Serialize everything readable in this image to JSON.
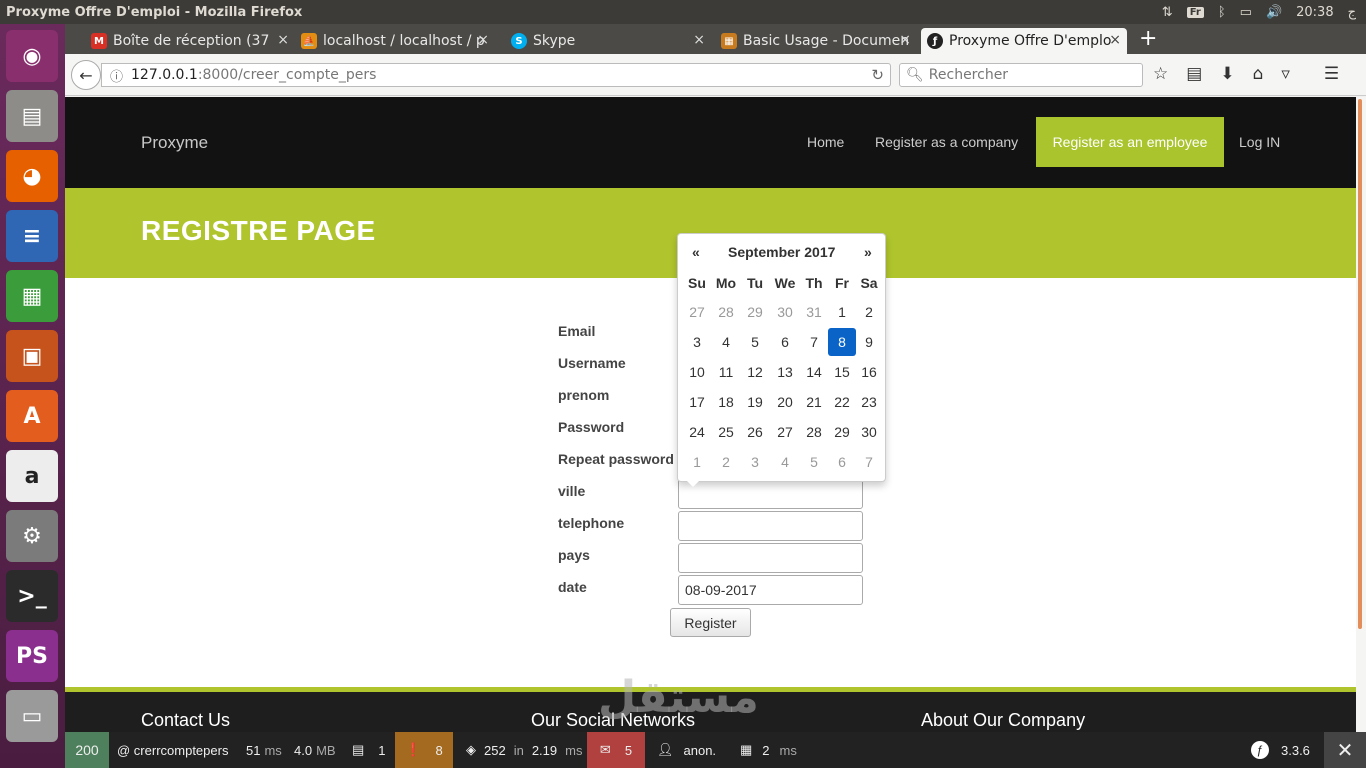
{
  "system": {
    "window_title": "Proxyme Offre D'emploi - Mozilla Firefox",
    "keyboard": "Fr",
    "time": "20:38",
    "locale_mark": "ج"
  },
  "tabs": [
    {
      "label": "Boîte de réception (37",
      "icon": "gmail-icon"
    },
    {
      "label": "localhost / localhost / p",
      "icon": "phpmyadmin-icon"
    },
    {
      "label": "Skype",
      "icon": "skype-icon"
    },
    {
      "label": "Basic Usage - Documen",
      "icon": "docs-icon"
    },
    {
      "label": "Proxyme Offre D'emplo",
      "icon": "symfony-icon"
    }
  ],
  "nav": {
    "url_host": "127.0.0.1",
    "url_path": ":8000/creer_compte_pers",
    "search_placeholder": "Rechercher"
  },
  "site": {
    "brand": "Proxyme",
    "menu": [
      "Home",
      "Register as a company",
      "Register as an employee",
      "Log IN"
    ],
    "page_title": "REGISTRE PAGE"
  },
  "form": {
    "labels": [
      "Email",
      "Username",
      "prenom",
      "Password",
      "Repeat password",
      "ville",
      "telephone",
      "pays",
      "date"
    ],
    "date_value": "08-09-2017",
    "submit_label": "Register"
  },
  "datepicker": {
    "prev": "«",
    "next": "»",
    "month_label": "September 2017",
    "weekdays": [
      "Su",
      "Mo",
      "Tu",
      "We",
      "Th",
      "Fr",
      "Sa"
    ],
    "weeks": [
      [
        "27",
        "28",
        "29",
        "30",
        "31",
        "1",
        "2"
      ],
      [
        "3",
        "4",
        "5",
        "6",
        "7",
        "8",
        "9"
      ],
      [
        "10",
        "11",
        "12",
        "13",
        "14",
        "15",
        "16"
      ],
      [
        "17",
        "18",
        "19",
        "20",
        "21",
        "22",
        "23"
      ],
      [
        "24",
        "25",
        "26",
        "27",
        "28",
        "29",
        "30"
      ],
      [
        "1",
        "2",
        "3",
        "4",
        "5",
        "6",
        "7"
      ]
    ],
    "selected": "8"
  },
  "footer": {
    "headings": [
      "Contact Us",
      "Our Social Networks",
      "About Our Company"
    ]
  },
  "toolbar": {
    "status": "200",
    "route": "@ crerrcomptepers",
    "time_value": "51",
    "time_unit": "ms",
    "memory_value": "4.0",
    "memory_unit": "MB",
    "forms_count": "1",
    "logs_count": "8",
    "queries": "252",
    "queries_in": "in",
    "queries_time": "2.19",
    "queries_unit": "ms",
    "translations": "5",
    "user": "anon.",
    "twig_time": "2",
    "twig_unit": "ms",
    "version": "3.3.6"
  },
  "colors": {
    "accent_green": "#b0c52d",
    "nav_dark": "#121212",
    "selected_day": "#0a64c8",
    "status_ok": "#4f805d",
    "logs_warning": "#a46a1f",
    "translation_error": "#b0413e"
  }
}
